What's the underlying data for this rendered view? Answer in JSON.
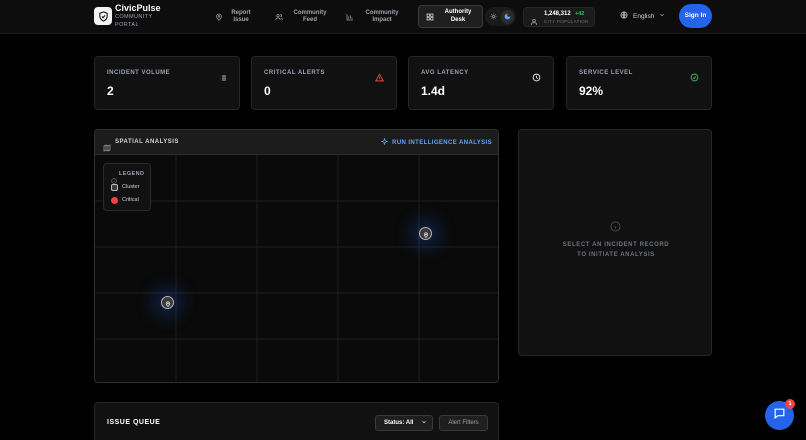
{
  "brand": {
    "name": "CivicPulse",
    "subtitle": "COMMUNITY PORTAL"
  },
  "nav": [
    {
      "label": "Report Issue",
      "icon": "map-pin-icon"
    },
    {
      "label": "Community Feed",
      "icon": "users-icon"
    },
    {
      "label": "Community Impact",
      "icon": "bar-chart-icon"
    },
    {
      "label": "Authority Desk",
      "icon": "grid-icon",
      "active": true
    }
  ],
  "theme": {
    "light_icon": "sun-icon",
    "dark_icon": "moon-icon",
    "active": "dark"
  },
  "population": {
    "value": "1,248,312",
    "delta": "+42",
    "label": "CITY POPULATION"
  },
  "language": "English",
  "signin_label": "Sign In",
  "stats": [
    {
      "title": "INCIDENT VOLUME",
      "value": "2",
      "icon": "list-icon",
      "color": "#e5e7eb"
    },
    {
      "title": "CRITICAL ALERTS",
      "value": "0",
      "icon": "alert-triangle-icon",
      "color": "#ef4444"
    },
    {
      "title": "AVG LATENCY",
      "value": "1.4d",
      "icon": "clock-icon",
      "color": "#e5e7eb"
    },
    {
      "title": "SERVICE LEVEL",
      "value": "92%",
      "icon": "check-circle-icon",
      "color": "#22c55e"
    }
  ],
  "map": {
    "title": "SPATIAL ANALYSIS",
    "action": "RUN INTELLIGENCE ANALYSIS",
    "legend": {
      "title": "LEGEND",
      "items": [
        {
          "label": "Cluster"
        },
        {
          "label": "Critical"
        }
      ]
    }
  },
  "detail": {
    "message": "SELECT AN INCIDENT RECORD TO INITIATE ANALYSIS"
  },
  "queue": {
    "title": "ISSUE QUEUE",
    "status_label": "Status: All",
    "alert_label": "Alert Filters"
  },
  "chat": {
    "badge": "1"
  },
  "colors": {
    "accent": "#2563eb",
    "link": "#60a5fa",
    "success": "#22c55e",
    "danger": "#ef4444"
  }
}
